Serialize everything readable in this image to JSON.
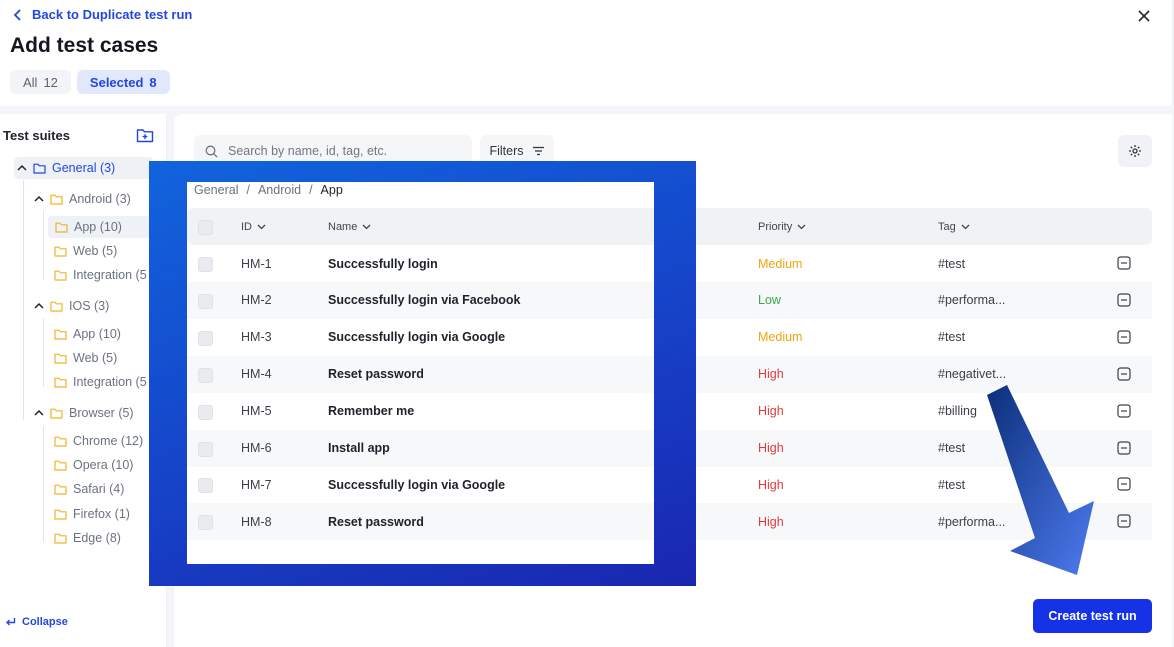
{
  "header": {
    "back_label": "Back to Duplicate test run",
    "title": "Add test cases",
    "tabs": [
      {
        "label": "All",
        "count": "12"
      },
      {
        "label": "Selected",
        "count": "8"
      }
    ]
  },
  "sidebar": {
    "title": "Test suites",
    "tree": [
      {
        "label": "General (3)"
      },
      {
        "label": "Android (3)"
      },
      {
        "label": "App (10)"
      },
      {
        "label": "Web (5)"
      },
      {
        "label": "Integration (5"
      },
      {
        "label": "IOS (3)"
      },
      {
        "label": "App (10)"
      },
      {
        "label": "Web (5)"
      },
      {
        "label": "Integration (5"
      },
      {
        "label": "Browser (5)"
      },
      {
        "label": "Chrome (12)"
      },
      {
        "label": "Opera (10)"
      },
      {
        "label": "Safari (4)"
      },
      {
        "label": "Firefox (1)"
      },
      {
        "label": "Edge (8)"
      }
    ],
    "collapse_label": "Collapse"
  },
  "toolbar": {
    "search_placeholder": "Search by name, id, tag, etc.",
    "filters_label": "Filters"
  },
  "breadcrumb": [
    "General",
    "/",
    "Android",
    "/",
    "App"
  ],
  "table": {
    "columns": {
      "id": "ID",
      "name": "Name",
      "priority": "Priority",
      "tag": "Tag"
    },
    "rows": [
      {
        "id": "HM-1",
        "name": "Successfully login",
        "priority": "Medium",
        "tag": "#test"
      },
      {
        "id": "HM-2",
        "name": "Successfully login via Facebook",
        "priority": "Low",
        "tag": "#performa..."
      },
      {
        "id": "HM-3",
        "name": "Successfully login via Google",
        "priority": "Medium",
        "tag": "#test"
      },
      {
        "id": "HM-4",
        "name": "Reset password",
        "priority": "High",
        "tag": "#negativet..."
      },
      {
        "id": "HM-5",
        "name": "Remember me",
        "priority": "High",
        "tag": "#billing"
      },
      {
        "id": "HM-6",
        "name": "Install app",
        "priority": "High",
        "tag": "#test"
      },
      {
        "id": "HM-7",
        "name": "Successfully login via Google",
        "priority": "High",
        "tag": "#test"
      },
      {
        "id": "HM-8",
        "name": "Reset password",
        "priority": "High",
        "tag": "#performa..."
      }
    ]
  },
  "footer": {
    "create_label": "Create test run"
  },
  "colors": {
    "accent": "#2446e0",
    "primary_button": "#1532e6",
    "priority_medium": "#f0a40c",
    "priority_low": "#3aa64a",
    "priority_high": "#e23a3a"
  },
  "icons": [
    "chevron-left-icon",
    "close-icon",
    "add-folder-icon",
    "folder-icon",
    "chevron-up-icon",
    "search-icon",
    "filter-icon",
    "gear-icon",
    "chevron-down-icon",
    "remove-icon",
    "collapse-icon",
    "arrow-annotation"
  ]
}
